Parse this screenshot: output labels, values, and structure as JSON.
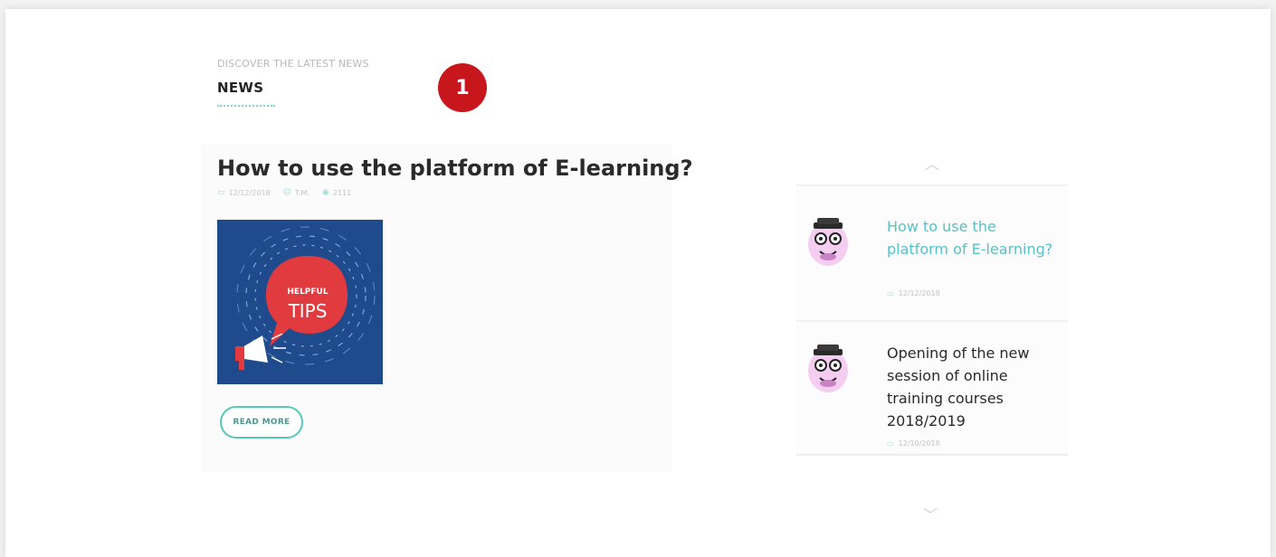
{
  "section": {
    "eyebrow": "DISCOVER THE LATEST NEWS",
    "title": "NEWS",
    "badge": "1"
  },
  "featured": {
    "title": "How to use the platform of E-learning?",
    "meta": {
      "date": "12/12/2018",
      "author": "T.M.",
      "views": "2111"
    },
    "image": {
      "top_label": "HELPFUL",
      "main_label": "TIPS"
    },
    "read_more": "READ MORE"
  },
  "list": {
    "items": [
      {
        "title": "How to use the platform of E-learning?",
        "date": "12/12/2018",
        "active": true
      },
      {
        "title": "Opening of the new session of online training courses 2018/2019",
        "date": "12/10/2018",
        "active": false
      }
    ]
  },
  "icons": {
    "up": "chevron-up-icon",
    "down": "chevron-down-icon",
    "calendar": "calendar-icon",
    "user": "user-icon",
    "eye": "eye-icon"
  },
  "colors": {
    "accent": "#56c2c6",
    "button_border": "#54c9bb",
    "badge": "#c8161d",
    "tips_bg": "#1f4a8b",
    "tips_bubble": "#e23b3f"
  }
}
